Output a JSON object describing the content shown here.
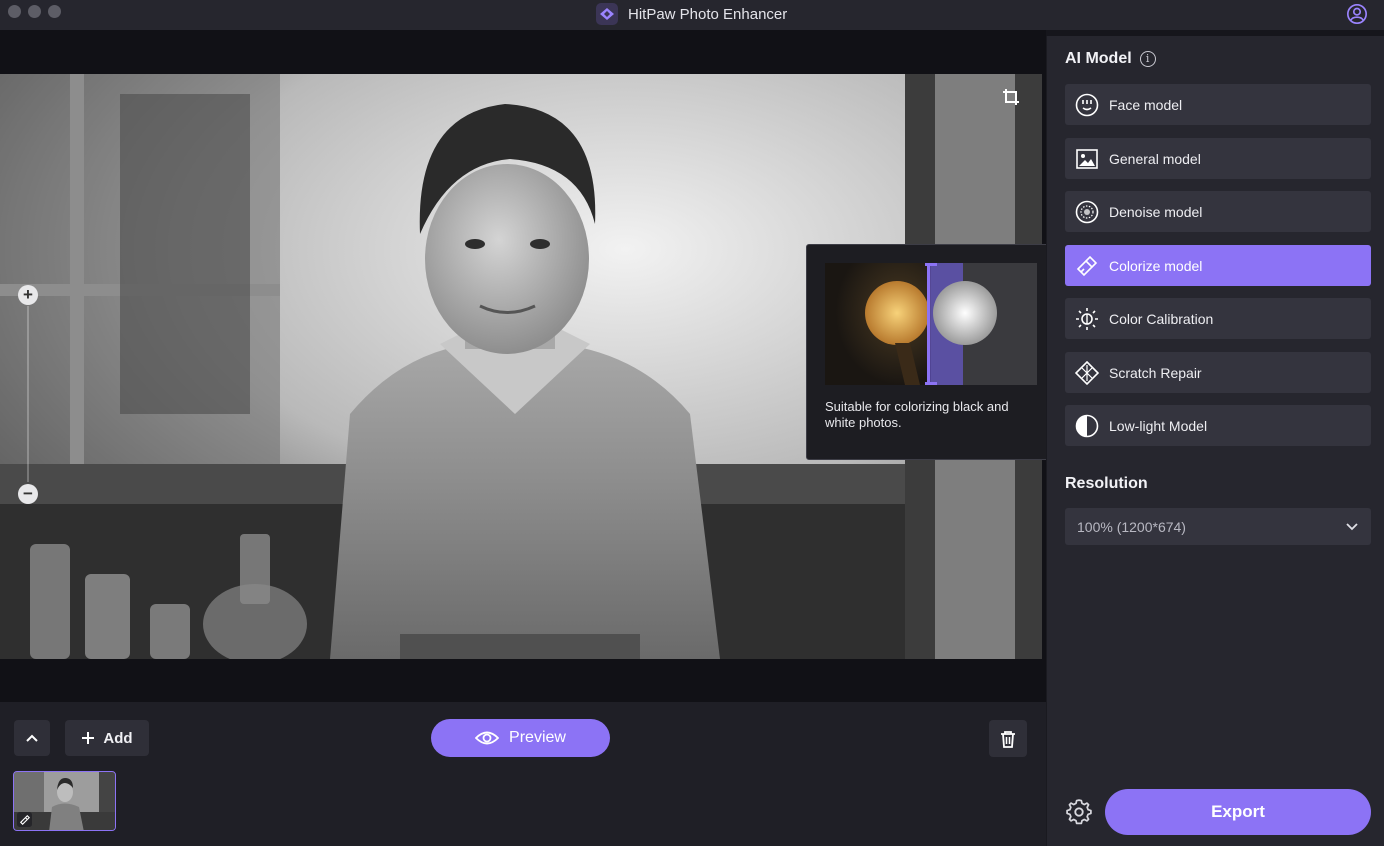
{
  "window": {
    "title": "HitPaw Photo Enhancer"
  },
  "tooltip": {
    "text": "Suitable for colorizing black and white photos."
  },
  "toolbar": {
    "add_label": "Add",
    "preview_label": "Preview"
  },
  "panel": {
    "ai_model_title": "AI Model",
    "models": [
      {
        "label": "Face model",
        "icon": "face-icon",
        "active": false
      },
      {
        "label": "General model",
        "icon": "image-icon",
        "active": false
      },
      {
        "label": "Denoise model",
        "icon": "denoise-icon",
        "active": false
      },
      {
        "label": "Colorize model",
        "icon": "colorize-icon",
        "active": true
      },
      {
        "label": "Color Calibration",
        "icon": "sun-calibration-icon",
        "active": false
      },
      {
        "label": "Scratch Repair",
        "icon": "scratch-repair-icon",
        "active": false
      },
      {
        "label": "Low-light Model",
        "icon": "half-circle-icon",
        "active": false
      }
    ],
    "resolution_title": "Resolution",
    "resolution_value": "100% (1200*674)",
    "export_label": "Export"
  },
  "colors": {
    "accent": "#8c73f5",
    "panel": "#26262e",
    "button": "#34343e"
  }
}
